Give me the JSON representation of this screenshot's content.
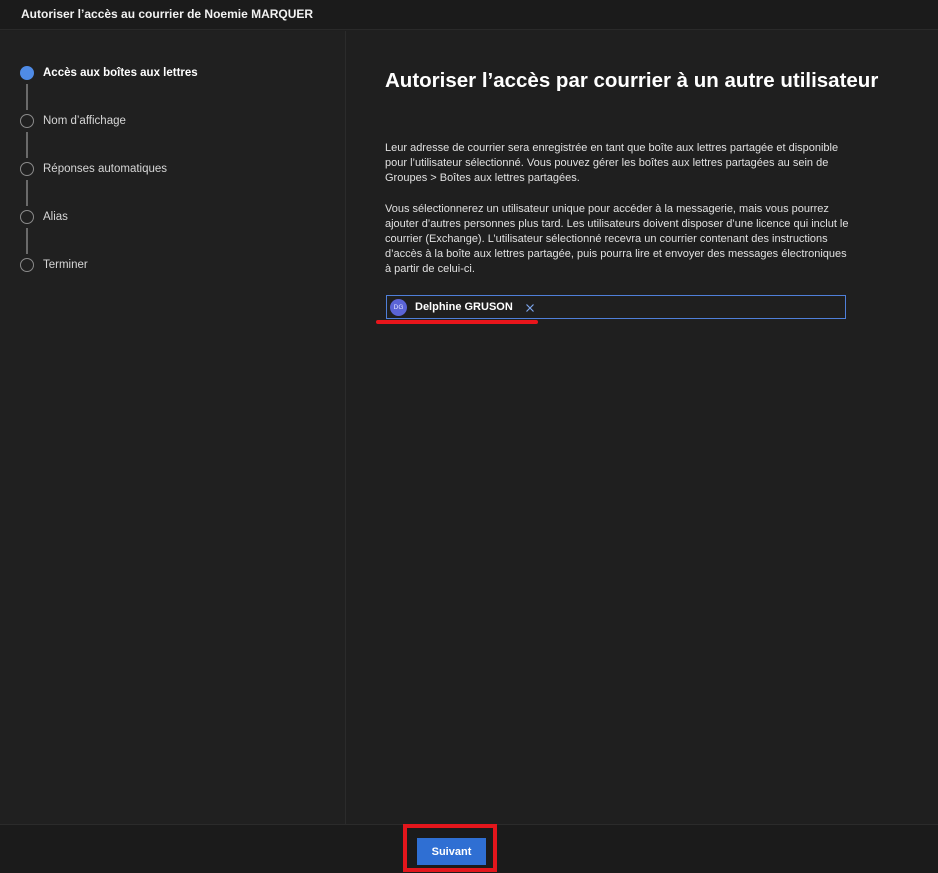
{
  "window": {
    "title": "Autoriser l’accès au courrier de Noemie MARQUER"
  },
  "steps": [
    {
      "label": "Accès aux boîtes aux lettres",
      "active": true
    },
    {
      "label": "Nom d’affichage",
      "active": false
    },
    {
      "label": "Réponses automatiques",
      "active": false
    },
    {
      "label": "Alias",
      "active": false
    },
    {
      "label": "Terminer",
      "active": false
    }
  ],
  "main": {
    "heading": "Autoriser l’accès par courrier à un autre utilisateur",
    "paragraph1": "Leur adresse de courrier sera enregistrée en tant que boîte aux lettres partagée et disponible pour l’utilisateur sélectionné. Vous pouvez gérer les boîtes aux lettres partagées au sein de Groupes > Boîtes aux lettres partagées.",
    "paragraph2": "Vous sélectionnerez un utilisateur unique pour accéder à la messagerie, mais vous pourrez ajouter d’autres personnes plus tard. Les utilisateurs doivent disposer d’une licence qui inclut le courrier (Exchange). L’utilisateur sélectionné recevra un courrier contenant des instructions d’accès à la boîte aux lettres partagée, puis pourra lire et envoyer des messages électroniques à partir de celui-ci."
  },
  "picker": {
    "selected_user": {
      "initials": "DG",
      "name": "Delphine GRUSON"
    },
    "remove_icon": "close-icon"
  },
  "footer": {
    "next_label": "Suivant"
  },
  "colors": {
    "accent": "#2f6fd3",
    "active_step": "#4f8be6",
    "annotation_red": "#e3161c",
    "avatar": "#5b64d6"
  }
}
